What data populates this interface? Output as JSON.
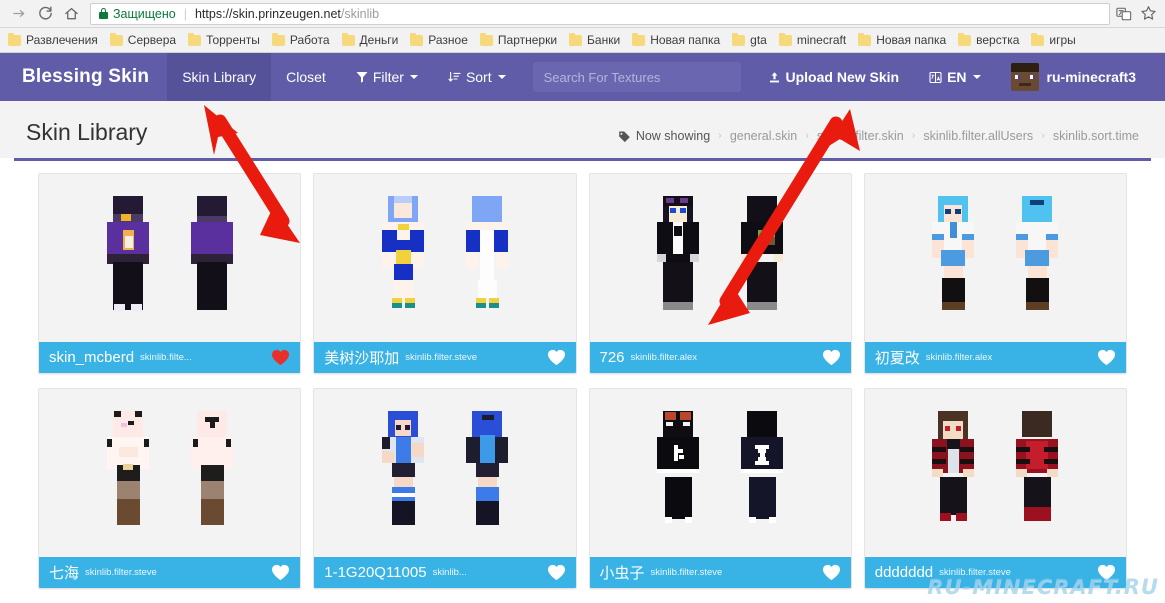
{
  "browser": {
    "nav_icons": [
      "forward-arrow",
      "reload",
      "home"
    ],
    "security_label": "Защищено",
    "url_main": "https://skin.prinzeugen.net",
    "url_path": "/skinlib",
    "right_icons": [
      "translate-icon",
      "star-icon"
    ],
    "bookmarks": [
      "Развлечения",
      "Сервера",
      "Торренты",
      "Работа",
      "Деньги",
      "Разное",
      "Партнерки",
      "Банки",
      "Новая папка",
      "gta",
      "minecraft",
      "Новая папка",
      "верстка",
      "игры"
    ]
  },
  "navbar": {
    "brand": "Blessing Skin",
    "links": [
      {
        "label": "Skin Library",
        "active": true
      },
      {
        "label": "Closet",
        "active": false
      },
      {
        "label": "Filter",
        "active": false,
        "icon": "filter-icon",
        "caret": true
      },
      {
        "label": "Sort",
        "active": false,
        "icon": "sort-icon",
        "caret": true
      }
    ],
    "search_placeholder": "Search For Textures",
    "search_value": "",
    "upload_label": "Upload New Skin",
    "upload_icon": "upload-icon",
    "language_label": "EN",
    "language_icon": "language-icon",
    "username": "ru-minecraft3",
    "brand_color": "#605ca8",
    "active_color": "#555299"
  },
  "page": {
    "title": "Skin Library",
    "breadcrumb": {
      "icon": "tag-icon",
      "label": "Now showing",
      "items": [
        "general.skin",
        "skinlib.filter.skin",
        "skinlib.filter.allUsers",
        "skinlib.sort.time"
      ]
    }
  },
  "library": {
    "footer_color": "#39b3e5",
    "cards": [
      {
        "name": "skin_mcberd",
        "sub": "skinlib.filte...",
        "liked": true,
        "heart_color": "#e8302a",
        "skin": "purple-hoodie"
      },
      {
        "name": "美树沙耶加",
        "sub": "skinlib.filter.steve",
        "liked": false,
        "heart_color": "#ffffff",
        "skin": "blue-sailor"
      },
      {
        "name": "726",
        "sub": "skinlib.filter.alex",
        "liked": false,
        "heart_color": "#ffffff",
        "skin": "black-suit"
      },
      {
        "name": "初夏改",
        "sub": "skinlib.filter.alex",
        "liked": false,
        "heart_color": "#ffffff",
        "skin": "school-girl"
      },
      {
        "name": "七海",
        "sub": "skinlib.filter.steve",
        "liked": false,
        "heart_color": "#ffffff",
        "skin": "pale-panda"
      },
      {
        "name": "1-1G20Q11005",
        "sub": "skinlib...",
        "liked": false,
        "heart_color": "#ffffff",
        "skin": "blue-hair"
      },
      {
        "name": "小虫子",
        "sub": "skinlib.filter.steve",
        "liked": false,
        "heart_color": "#ffffff",
        "skin": "black-k"
      },
      {
        "name": "ddddddd",
        "sub": "skinlib.filter.steve",
        "liked": false,
        "heart_color": "#ffffff",
        "skin": "red-jacket"
      }
    ]
  },
  "watermark": "RU-MINECRAFT.RU"
}
